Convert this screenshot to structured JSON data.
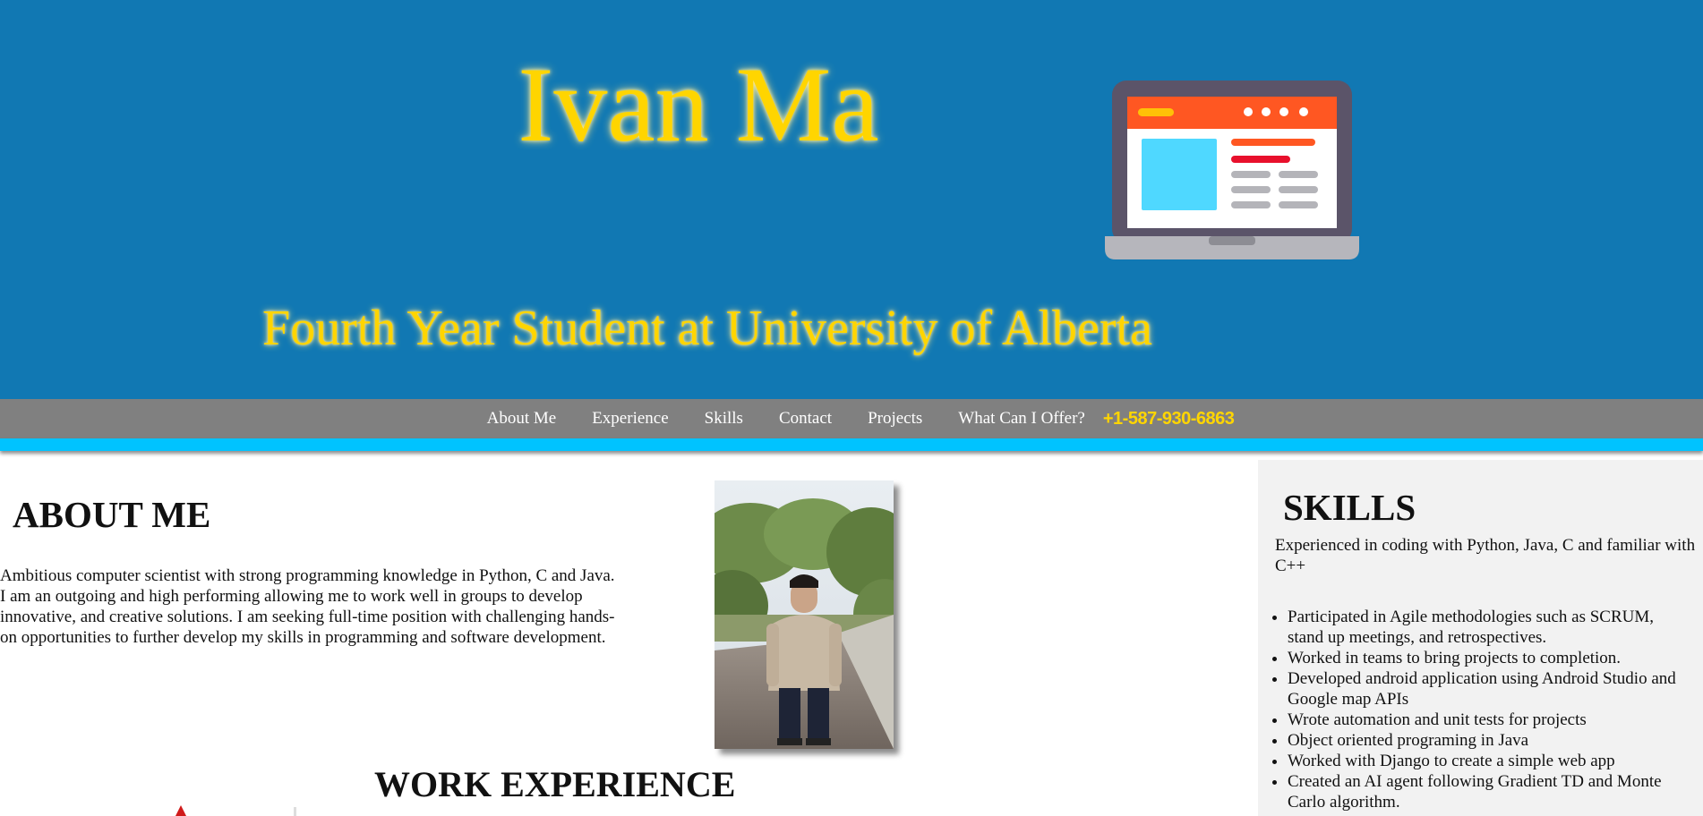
{
  "header": {
    "name": "Ivan Ma",
    "subtitle": "Fourth Year Student at University of Alberta",
    "laptop_icon": "laptop-browser-icon"
  },
  "nav": {
    "items": [
      "About Me",
      "Experience",
      "Skills",
      "Contact",
      "Projects",
      "What Can I Offer?"
    ],
    "phone": "+1-587-930-6863"
  },
  "about": {
    "heading": "ABOUT ME",
    "text": "Ambitious computer scientist with strong programming knowledge in Python, C and Java. I am an outgoing and high performing allowing me to work well in groups to develop innovative, and creative solutions. I am seeking full-time position with challenging hands-on opportunities to further develop my skills in programming and software development."
  },
  "work": {
    "heading": "WORK EXPERIENCE"
  },
  "skills": {
    "heading": "SKILLS",
    "intro": "Experienced in coding with Python, Java, C and familiar with C++",
    "items": [
      "Participated in Agile methodologies such as SCRUM, stand up meetings, and retrospectives.",
      "Worked in teams to bring projects to completion.",
      "Developed android application using Android Studio and Google map APIs",
      "Wrote automation and unit tests for projects",
      "Object oriented programing in Java",
      "Worked with Django to create a simple web app",
      "Created an AI agent following Gradient TD and Monte Carlo algorithm."
    ]
  },
  "colors": {
    "header_bg": "#1178b3",
    "title_yellow": "#ffd500",
    "nav_bg": "#808080",
    "nav_accent": "#00c3ff",
    "skills_bg": "#f2f2f2"
  }
}
